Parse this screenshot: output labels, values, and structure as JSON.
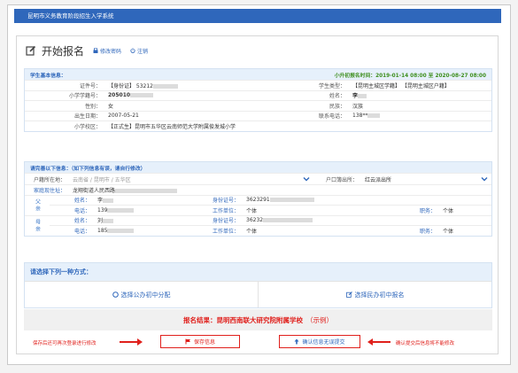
{
  "app": {
    "title": "昆明市义务教育阶段招生入学系统"
  },
  "header": {
    "title": "开始报名",
    "change_password": "修改密码",
    "logout": "注销"
  },
  "student": {
    "section_title": "学生基本信息：",
    "period": "小升初报名时间：2019-01-14 08:00 至 2020-08-27 08:00",
    "id_label": "证件号：",
    "id_value": "【身份证】 53212",
    "type_label": "学生类型：",
    "type_value": "【昆明主城区学籍】 【昆明主城区户籍】",
    "xj_label": "小学学籍号：",
    "xj_value": "205010",
    "name_label": "姓名：",
    "name_value": "李",
    "gender_label": "性别：",
    "gender_value": "女",
    "nation_label": "民族：",
    "nation_value": "汉族",
    "birth_label": "出生日期：",
    "birth_value": "2007-05-21",
    "phone_label": "联系电话：",
    "phone_value": "138**",
    "school_label": "小学校区：",
    "school_value": "【正式生】昆明市五华区云南师范大学附属俊发城小学"
  },
  "confirm": {
    "section_title": "请完善以下信息：（如下列信息有误，请自行修改）",
    "hukou_label": "户籍所在地：",
    "hukou_value": "云南省 / 昆明市 / 五华区",
    "police_label": "户口簿出所：",
    "police_value": "红云派出所",
    "addr_label": "家庭现住址：",
    "addr_value": "龙翔街道人民西路",
    "father_side": "父亲",
    "mother_side": "母亲",
    "name_label": "姓名：",
    "idno_label": "身份证号：",
    "tel_label": "电话：",
    "work_label": "工作单位：",
    "job_label": "职务：",
    "father_name": "李",
    "father_id": "3623291",
    "father_tel": "139",
    "father_work": "个体",
    "father_job": "个体",
    "mother_name": "刘",
    "mother_id": "36232",
    "mother_tel": "185",
    "mother_work": "个体",
    "mother_job": "个体"
  },
  "choose": {
    "title": "请选择下列一种方式：",
    "option_public": "选择公办初中分配",
    "option_private": "选择民办初中报名"
  },
  "result": {
    "text": "报名结果：昆明西南联大研究院附属学校",
    "example": "（示例）"
  },
  "actions": {
    "left_note": "保存后还可再次登录进行修改",
    "save": "保存信息",
    "submit": "确认信息无误提交",
    "right_note": "确认提交后信息将不能修改"
  },
  "colors": {
    "header_blue": "#2f67bb",
    "accent_red": "#e0201c",
    "period_green": "#3f8f1f"
  }
}
